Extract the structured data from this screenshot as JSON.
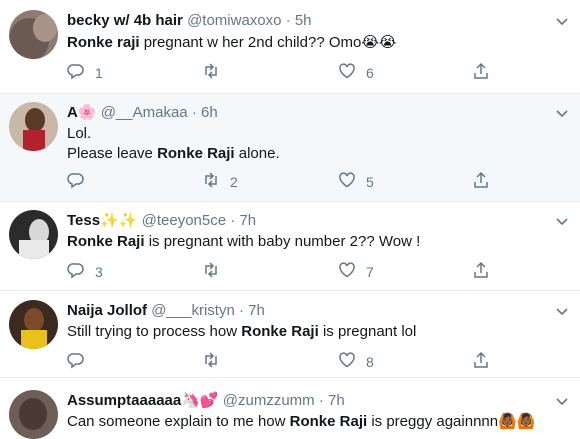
{
  "tweets": [
    {
      "name": "becky w/ 4b hair",
      "name_emoji": "",
      "handle": "@tomiwaxoxo",
      "time": "5h",
      "lines": [
        {
          "pre": "",
          "bold": "Ronke raji",
          "post": " pregnant w her 2nd child?? Omo😭😭"
        }
      ],
      "replies": "1",
      "retweets": "",
      "likes": "6"
    },
    {
      "name": "A🌸",
      "name_emoji": "",
      "handle": "@__Amakaa",
      "time": "6h",
      "lines": [
        {
          "pre": "Lol.",
          "bold": "",
          "post": ""
        },
        {
          "pre": "Please leave ",
          "bold": "Ronke Raji",
          "post": " alone."
        }
      ],
      "replies": "",
      "retweets": "2",
      "likes": "5"
    },
    {
      "name": "Tess✨✨",
      "name_emoji": "",
      "handle": "@teeyon5ce",
      "time": "7h",
      "lines": [
        {
          "pre": "",
          "bold": "Ronke Raji",
          "post": " is pregnant with baby number 2?? Wow !"
        }
      ],
      "replies": "3",
      "retweets": "",
      "likes": "7"
    },
    {
      "name": "Naija Jollof",
      "name_emoji": "",
      "handle": "@___kristyn",
      "time": "7h",
      "lines": [
        {
          "pre": "Still trying to process how ",
          "bold": "Ronke Raji",
          "post": " is pregnant lol"
        }
      ],
      "replies": "",
      "retweets": "",
      "likes": "8"
    },
    {
      "name": "Assumptaaaaaa🦄💕",
      "name_emoji": "",
      "handle": "@zumzzumm",
      "time": "7h",
      "lines": [
        {
          "pre": "Can someone explain to me how ",
          "bold": "Ronke Raji",
          "post": " is preggy againnnn🙆🏾🙆🏾"
        }
      ],
      "replies": "",
      "retweets": "",
      "likes": ""
    }
  ],
  "colors": {
    "text": "#14171a",
    "muted": "#657786",
    "border": "#e6ecf0",
    "highlight_bg": "#f5f8fa"
  },
  "icons": {
    "reply": "reply-icon",
    "retweet": "retweet-icon",
    "like": "heart-icon",
    "share": "share-icon",
    "menu": "chevron-down-icon"
  }
}
